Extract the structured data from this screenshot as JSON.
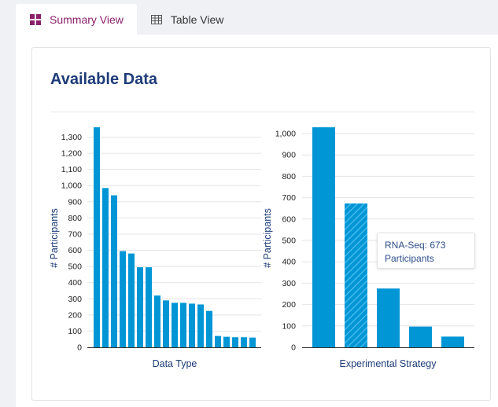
{
  "tabs": [
    {
      "label": "Summary View",
      "icon": "grid-icon",
      "active": true
    },
    {
      "label": "Table View",
      "icon": "table-icon",
      "active": false
    }
  ],
  "card": {
    "title": "Available Data"
  },
  "colors": {
    "bar": "#0096d6",
    "accent": "#8b1f6a",
    "title": "#1d3b78"
  },
  "chart_data": [
    {
      "type": "bar",
      "title": "",
      "xlabel": "Data Type",
      "ylabel": "# Participants",
      "ylim": [
        0,
        1300
      ],
      "yticks": [
        0,
        100,
        200,
        300,
        400,
        500,
        600,
        700,
        800,
        900,
        1000,
        1100,
        1200,
        1300
      ],
      "ytick_labels": [
        "0",
        "100",
        "200",
        "300",
        "400",
        "500",
        "600",
        "700",
        "800",
        "900",
        "1,000",
        "1,100",
        "1,200",
        "1,300"
      ],
      "values": [
        1365,
        985,
        940,
        595,
        580,
        495,
        495,
        320,
        290,
        275,
        275,
        270,
        265,
        225,
        70,
        65,
        62,
        62,
        60
      ],
      "grid": true
    },
    {
      "type": "bar",
      "title": "",
      "xlabel": "Experimental Strategy",
      "ylabel": "# Participants",
      "ylim": [
        0,
        1000
      ],
      "yticks": [
        0,
        100,
        200,
        300,
        400,
        500,
        600,
        700,
        800,
        900,
        1000
      ],
      "ytick_labels": [
        "0",
        "100",
        "200",
        "300",
        "400",
        "500",
        "600",
        "700",
        "800",
        "900",
        "1,000"
      ],
      "values": [
        1030,
        673,
        275,
        97,
        50
      ],
      "highlight_index": 1,
      "tooltip": {
        "line1": "RNA-Seq: 673",
        "line2": "Participants"
      },
      "grid": true
    }
  ]
}
